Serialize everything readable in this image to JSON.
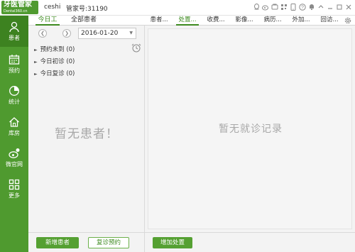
{
  "header": {
    "logo_text": "牙医管家",
    "logo_sub": "Dental360.cn",
    "user_name": "ceshi",
    "account_label": "管家号:31190",
    "window_icons": [
      "qq-icon",
      "weibo-icon",
      "phone-icon",
      "qr-icon",
      "mobile-icon",
      "help-icon",
      "bell-icon",
      "restore-icon",
      "minimize-icon",
      "maximize-icon",
      "close-icon"
    ]
  },
  "sidebar": {
    "items": [
      {
        "label": "患者",
        "icon": "person-icon"
      },
      {
        "label": "预约",
        "icon": "calendar-icon"
      },
      {
        "label": "统计",
        "icon": "pie-chart-icon"
      },
      {
        "label": "库房",
        "icon": "house-icon"
      },
      {
        "label": "微官网",
        "icon": "weibo-site-icon"
      },
      {
        "label": "更多",
        "icon": "grid-icon"
      }
    ]
  },
  "patient_tabs": {
    "today": "今日工作",
    "all": "全部患者"
  },
  "date_picker": {
    "value": "2016-01-20"
  },
  "groups": [
    {
      "label": "预约未到 (0)"
    },
    {
      "label": "今日初诊 (0)"
    },
    {
      "label": "今日复诊 (0)"
    }
  ],
  "empty_patients": "暂无患者！",
  "left_footer": {
    "new_patient": "新增患者",
    "followup": "复诊预约"
  },
  "record_tabs": [
    {
      "label": "患者..."
    },
    {
      "label": "处置..."
    },
    {
      "label": "收费..."
    },
    {
      "label": "影像..."
    },
    {
      "label": "病历..."
    },
    {
      "label": "外加..."
    },
    {
      "label": "回访..."
    }
  ],
  "empty_records": "暂无就诊记录",
  "right_footer": {
    "add_treatment": "增加处置"
  },
  "colors": {
    "brand_green": "#4f9a2f",
    "active_green": "#3d8220"
  }
}
